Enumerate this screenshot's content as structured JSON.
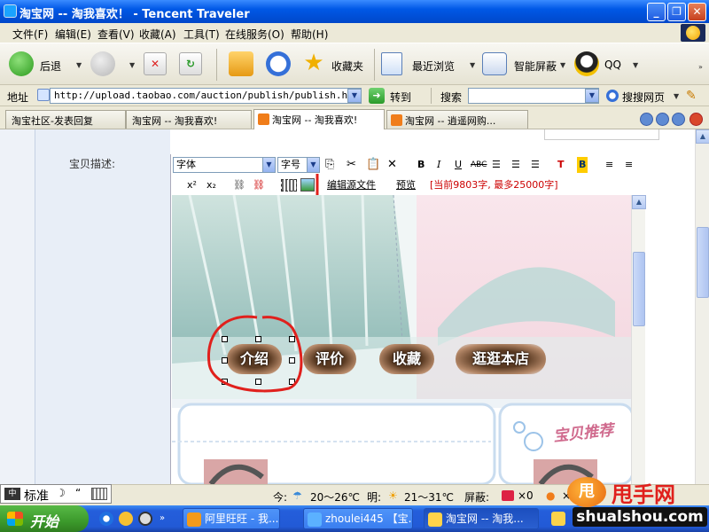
{
  "window": {
    "title": "淘宝网 -- 淘我喜欢！  - Tencent Traveler"
  },
  "menu": [
    "文件(F)",
    "编辑(E)",
    "查看(V)",
    "收藏(A)",
    "工具(T)",
    "在线服务(O)",
    "帮助(H)"
  ],
  "toolbar": {
    "back": "后退",
    "favorites": "收藏夹",
    "history": "最近浏览",
    "block": "智能屏蔽",
    "qq": "QQ"
  },
  "address": {
    "label": "地址",
    "url": "http://upload.taobao.com/auction/publish/publish.htm",
    "go": "转到",
    "search_label": "搜索",
    "search_value": "",
    "search_engine": "搜搜网页"
  },
  "tabs": [
    {
      "label": "淘宝社区-发表回复"
    },
    {
      "label": "淘宝网 -- 淘我喜欢!"
    },
    {
      "label": "淘宝网 -- 淘我喜欢!"
    },
    {
      "label": "淘宝网 -- 逍遥网购..."
    }
  ],
  "form": {
    "desc_label": "宝贝描述:",
    "font_select": "字体",
    "size_select": "字号",
    "edit_source": "编辑源文件",
    "preview": "预览",
    "counter": "[当前9803字, 最多25000字]"
  },
  "banner": {
    "buttons": [
      "介绍",
      "评价",
      "收藏",
      "逛逛本店"
    ],
    "promo_text": "宝贝推荐"
  },
  "status": {
    "today_label": "今:",
    "today_temp": "20～26℃",
    "tomorrow_label": "明:",
    "tomorrow_temp": "21～31℃",
    "block_label": "屏蔽:",
    "block_count1": "×0",
    "block_count2": "×0"
  },
  "ime": {
    "mode": "标准"
  },
  "taskbar": {
    "start": "开始",
    "tasks": [
      "阿里旺旺 - 我...",
      "zhoulei445 【宝...",
      "淘宝网 -- 淘我..."
    ]
  },
  "watermark": {
    "title": "甩手网",
    "url": "shualshou.com"
  },
  "colors": {
    "annotation_red": "#e0201c",
    "title_blue": "#0058e6",
    "start_green": "#3c9a2c"
  }
}
